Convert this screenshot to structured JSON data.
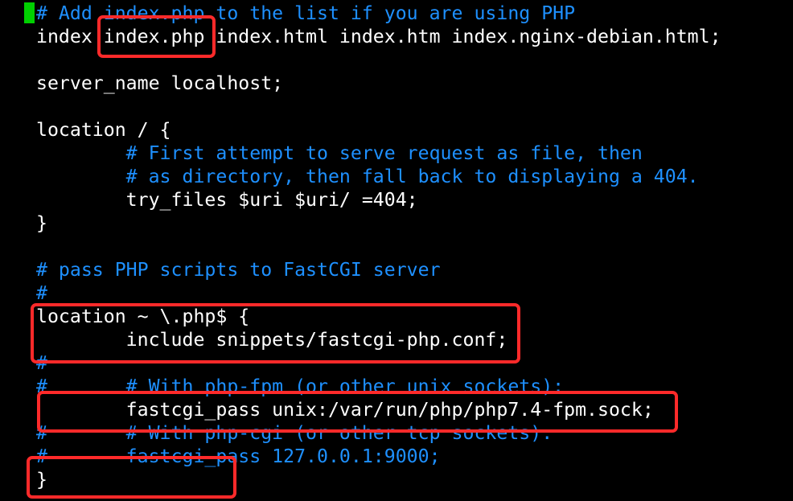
{
  "editor": {
    "lines": [
      {
        "text": "# Add index.php to the list if you are using PHP",
        "kind": "comment"
      },
      {
        "text": "index index.php index.html index.htm index.nginx-debian.html;",
        "kind": "code"
      },
      {
        "text": "",
        "kind": "blank"
      },
      {
        "text": "server_name localhost;",
        "kind": "code"
      },
      {
        "text": "",
        "kind": "blank"
      },
      {
        "text": "location / {",
        "kind": "code"
      },
      {
        "text": "        # First attempt to serve request as file, then",
        "kind": "comment"
      },
      {
        "text": "        # as directory, then fall back to displaying a 404.",
        "kind": "comment"
      },
      {
        "text": "        try_files $uri $uri/ =404;",
        "kind": "code"
      },
      {
        "text": "}",
        "kind": "code"
      },
      {
        "text": "",
        "kind": "blank"
      },
      {
        "text": "# pass PHP scripts to FastCGI server",
        "kind": "comment"
      },
      {
        "text": "#",
        "kind": "comment"
      },
      {
        "text": "location ~ \\.php$ {",
        "kind": "code"
      },
      {
        "text": "        include snippets/fastcgi-php.conf;",
        "kind": "code"
      },
      {
        "text": "#",
        "kind": "comment"
      },
      {
        "text": "#       # With php-fpm (or other unix sockets):",
        "kind": "comment"
      },
      {
        "text": "        fastcgi_pass unix:/var/run/php/php7.4-fpm.sock;",
        "kind": "code"
      },
      {
        "text": "#       # With php-cgi (or other tcp sockets):",
        "kind": "comment"
      },
      {
        "text": "#       fastcgi_pass 127.0.0.1:9000;",
        "kind": "comment"
      },
      {
        "text": "}",
        "kind": "code"
      }
    ]
  },
  "colors": {
    "background": "#000000",
    "code_text": "#ffffff",
    "comment_text": "#1e90ff",
    "cursor": "#00d000",
    "highlight_box": "#ff2a2a"
  }
}
